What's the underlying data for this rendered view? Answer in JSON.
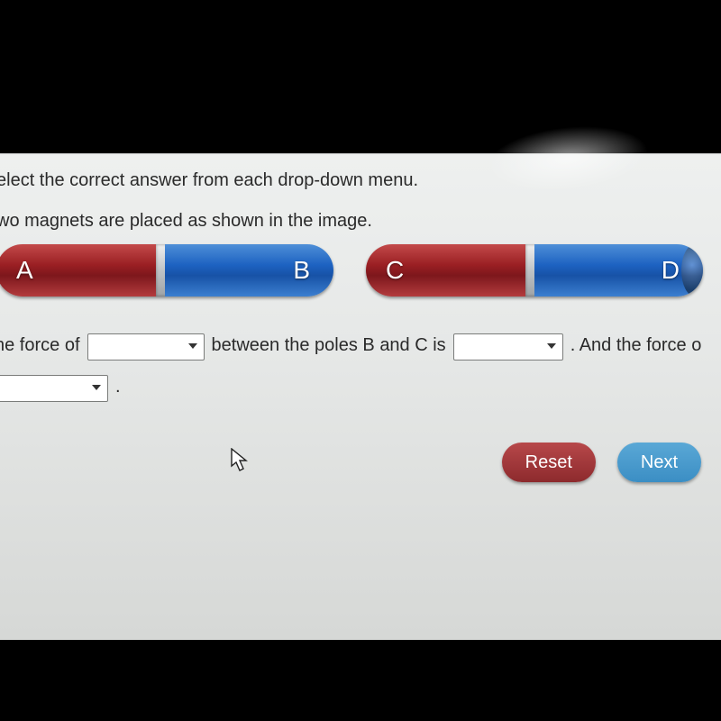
{
  "instruction_line1": "elect the correct answer from each drop-down menu.",
  "instruction_line2": "wo magnets are placed as shown in the image.",
  "magnets": [
    {
      "left_label": "A",
      "right_label": "B"
    },
    {
      "left_label": "C",
      "right_label": "D"
    }
  ],
  "sentence": {
    "part1": "he force of",
    "part2": "between the poles B and C is",
    "part3": ". And the force o",
    "part4": "."
  },
  "buttons": {
    "reset": "Reset",
    "next": "Next"
  }
}
